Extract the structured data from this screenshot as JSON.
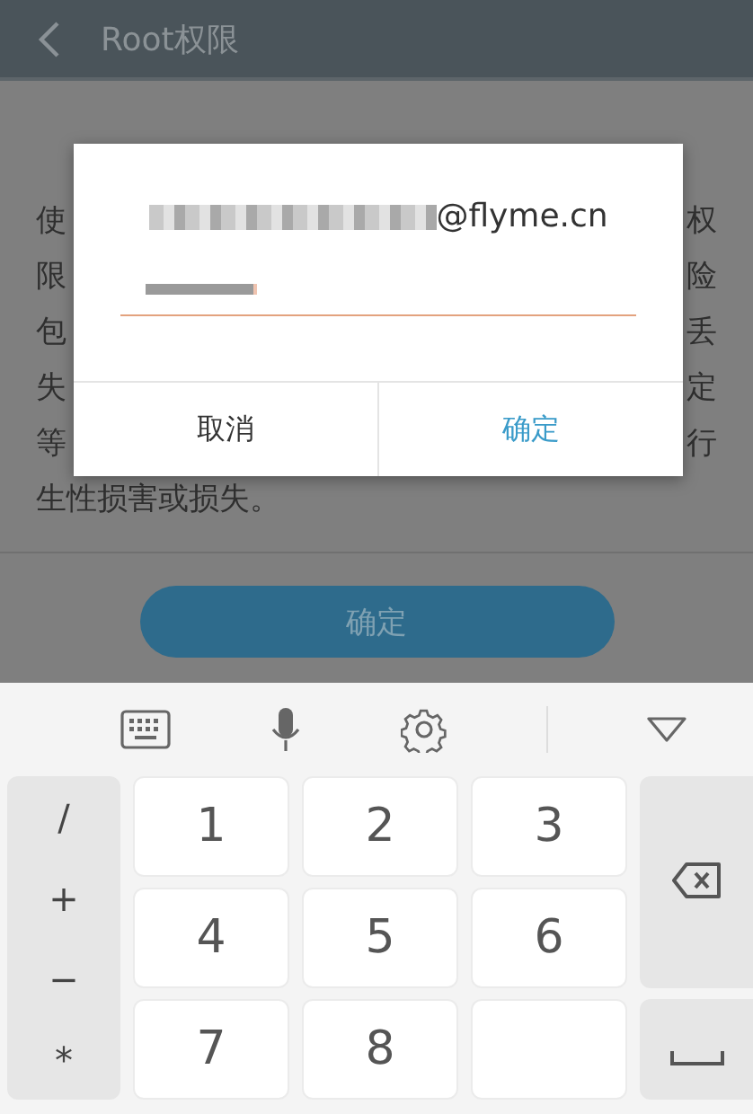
{
  "header": {
    "title": "Root权限"
  },
  "body": {
    "lines": [
      {
        "start": "使",
        "end": "权"
      },
      {
        "start": "限",
        "end": "险"
      },
      {
        "start": "包",
        "end": "丢"
      },
      {
        "start": "失",
        "end": "定"
      },
      {
        "start": "等",
        "end": "行"
      }
    ],
    "last_line": "生性损害或损失。",
    "button": {
      "label": "确定"
    }
  },
  "dialog": {
    "account_suffix": "@flyme.cn",
    "buttons": [
      {
        "label": "取消",
        "kind": "cancel"
      },
      {
        "label": "确定",
        "kind": "confirm"
      }
    ]
  },
  "keyboard": {
    "left_keys": [
      "/",
      "+",
      "−",
      "*"
    ],
    "number_keys": [
      "1",
      "2",
      "3",
      "4",
      "5",
      "6",
      "7",
      "8"
    ]
  }
}
